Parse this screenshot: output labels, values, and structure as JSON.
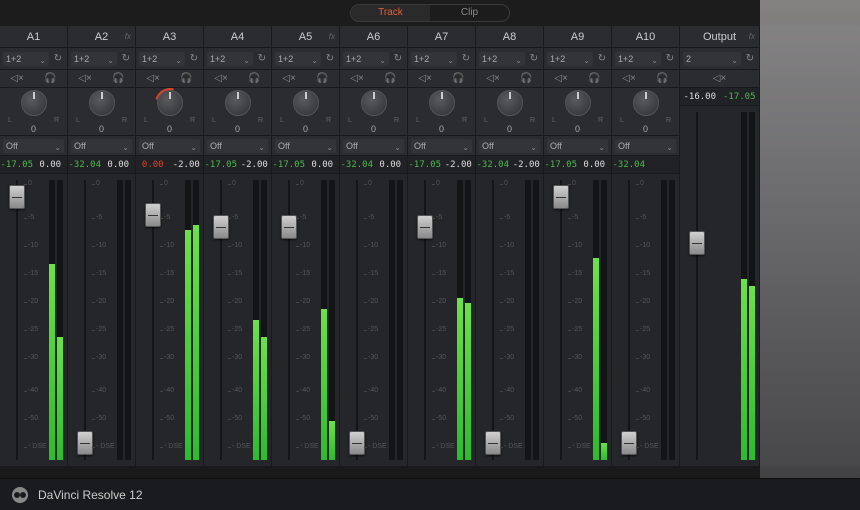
{
  "tabs": {
    "track": "Track",
    "clip": "Clip",
    "active": "track"
  },
  "route_label": "1+2",
  "off_label": "Off",
  "pan_lr": {
    "l": "L",
    "r": "R"
  },
  "scale_ticks": [
    "0",
    "-5",
    "-10",
    "-15",
    "-20",
    "-25",
    "-30",
    "-40",
    "-50",
    "- DSE"
  ],
  "strips": [
    {
      "name": "A1",
      "fx": false,
      "pan": "0",
      "ro1": "-17.05",
      "ro1c": "c-green",
      "ro2": "0.00",
      "ro2c": "c-white",
      "fader": 92,
      "meterL": 70,
      "meterR": 44,
      "route": true
    },
    {
      "name": "A2",
      "fx": true,
      "pan": "0",
      "ro1": "-32.04",
      "ro1c": "c-green",
      "ro2": "0.00",
      "ro2c": "c-white",
      "fader": 8,
      "meterL": 0,
      "meterR": 0,
      "route": true
    },
    {
      "name": "A3",
      "fx": false,
      "pan": "0",
      "pan_red": true,
      "ro1": "0.00",
      "ro1c": "c-red",
      "ro2": "-2.00",
      "ro2c": "c-white",
      "fader": 86,
      "meterL": 82,
      "meterR": 84,
      "route": true
    },
    {
      "name": "A4",
      "fx": false,
      "pan": "0",
      "ro1": "-17.05",
      "ro1c": "c-green",
      "ro2": "-2.00",
      "ro2c": "c-white",
      "fader": 82,
      "meterL": 50,
      "meterR": 44,
      "route": true
    },
    {
      "name": "A5",
      "fx": true,
      "pan": "0",
      "ro1": "-17.05",
      "ro1c": "c-green",
      "ro2": "0.00",
      "ro2c": "c-white",
      "fader": 82,
      "meterL": 54,
      "meterR": 14,
      "route": true
    },
    {
      "name": "A6",
      "fx": false,
      "pan": "0",
      "ro1": "-32.04",
      "ro1c": "c-green",
      "ro2": "0.00",
      "ro2c": "c-white",
      "fader": 8,
      "meterL": 0,
      "meterR": 0,
      "route": true
    },
    {
      "name": "A7",
      "fx": false,
      "pan": "0",
      "ro1": "-17.05",
      "ro1c": "c-green",
      "ro2": "-2.00",
      "ro2c": "c-white",
      "fader": 82,
      "meterL": 58,
      "meterR": 56,
      "route": true
    },
    {
      "name": "A8",
      "fx": false,
      "pan": "0",
      "ro1": "-32.04",
      "ro1c": "c-green",
      "ro2": "-2.00",
      "ro2c": "c-white",
      "fader": 8,
      "meterL": 0,
      "meterR": 0,
      "route": true
    },
    {
      "name": "A9",
      "fx": false,
      "pan": "0",
      "ro1": "-17.05",
      "ro1c": "c-green",
      "ro2": "0.00",
      "ro2c": "c-white",
      "fader": 92,
      "meterL": 72,
      "meterR": 6,
      "route": true
    },
    {
      "name": "A10",
      "fx": false,
      "pan": "0",
      "ro1": "-32.04",
      "ro1c": "c-green",
      "ro2": "",
      "ro2c": "c-white",
      "fader": 8,
      "meterL": 0,
      "meterR": 0,
      "route": true
    }
  ],
  "output": {
    "name": "Output",
    "fx": true,
    "route": "2",
    "ro1": "-16.00",
    "ro2": "-17.05",
    "fader": 62,
    "meterL": 52,
    "meterR": 50
  },
  "footer": {
    "app": "DaVinci Resolve 12"
  }
}
